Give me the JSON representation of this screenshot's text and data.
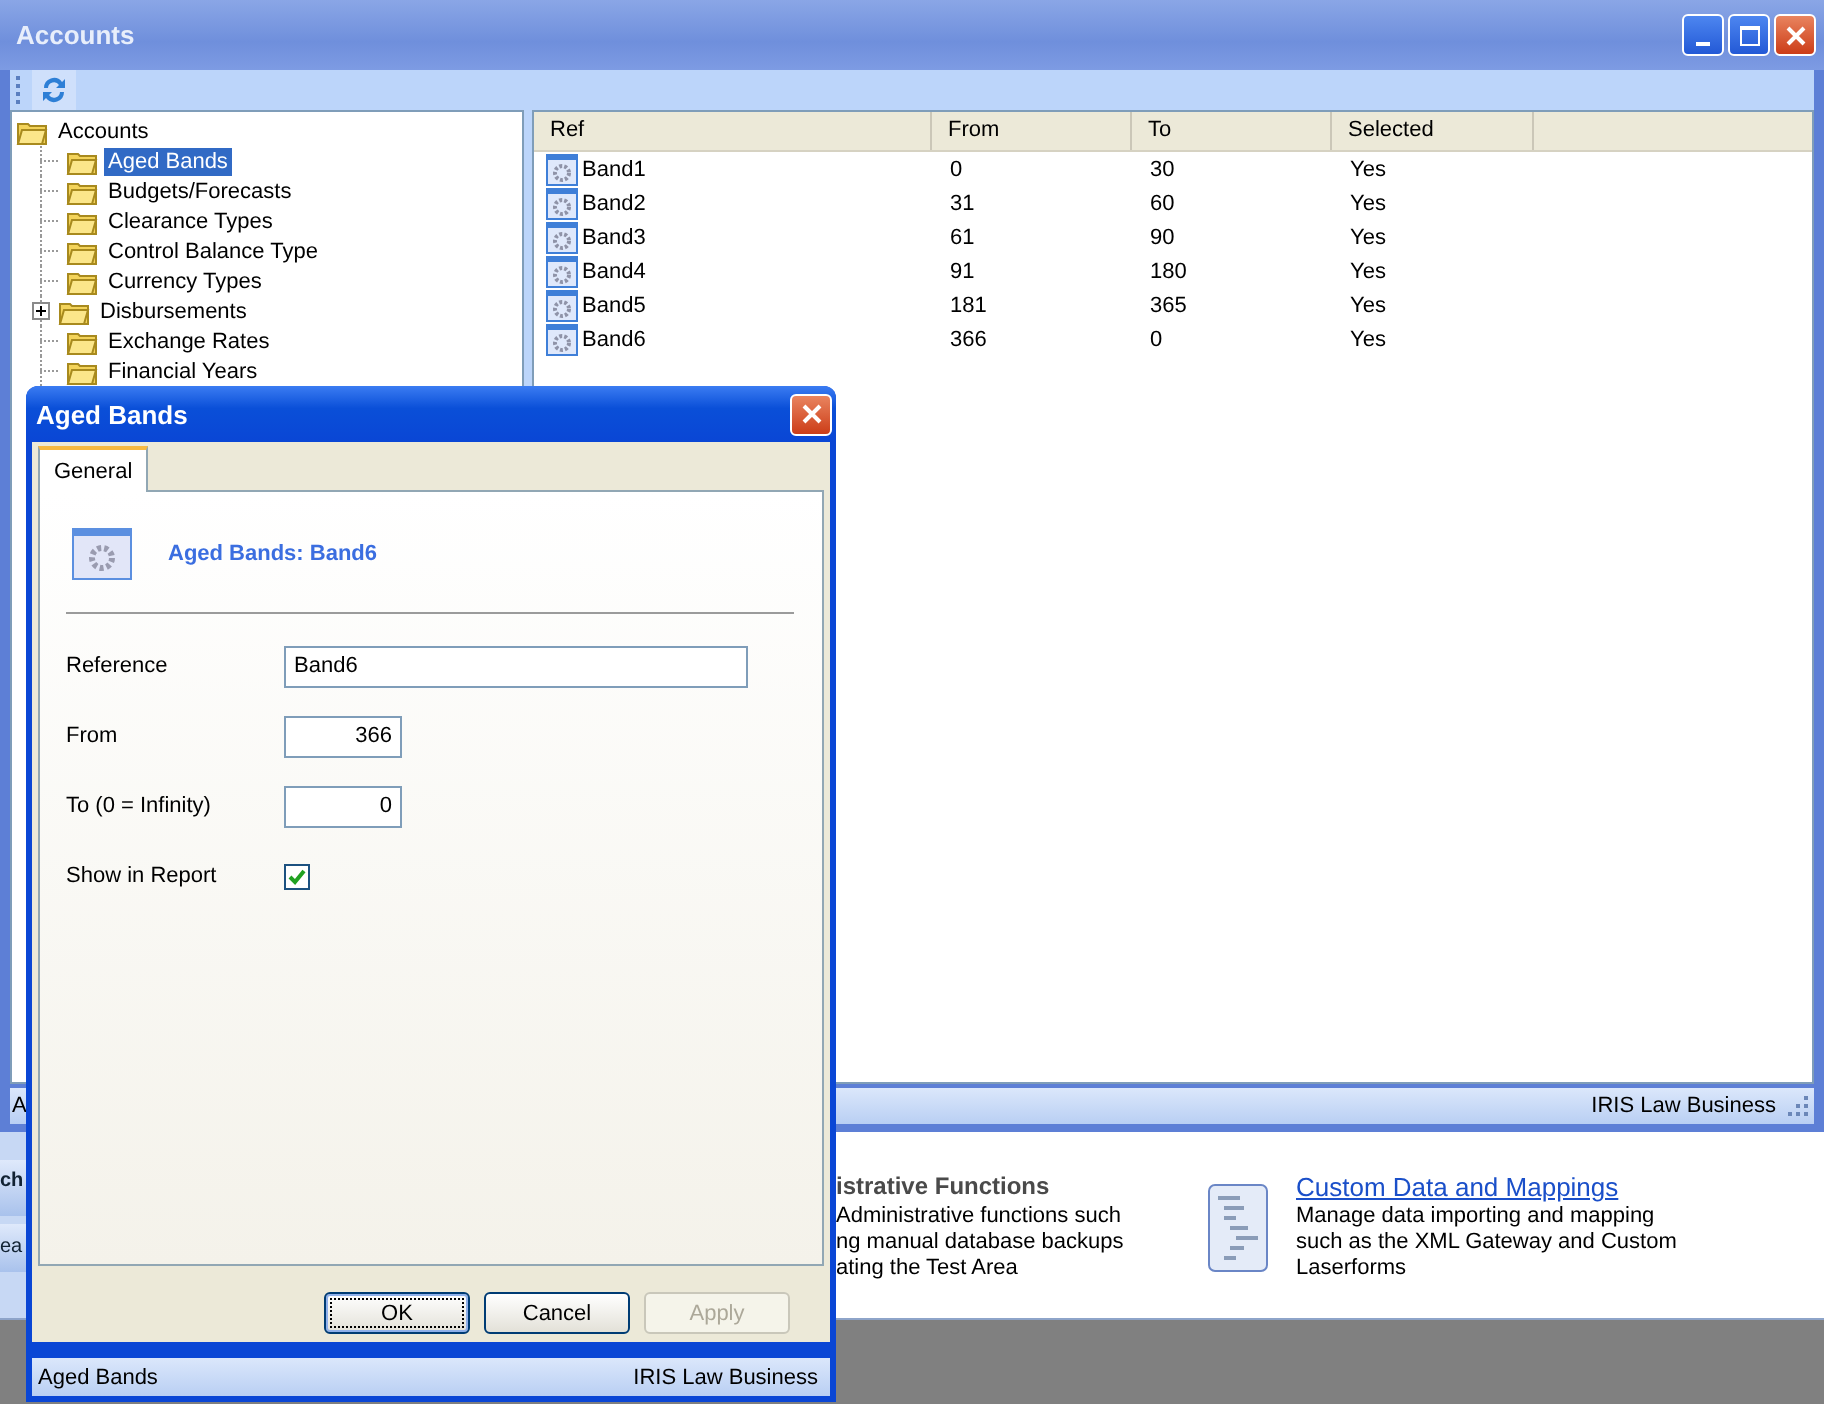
{
  "background_app": {
    "sidebar_items": [
      {
        "label": "ch",
        "kind": "bold"
      },
      {
        "label": "ea",
        "kind": "plain"
      }
    ],
    "features": [
      {
        "title": "istrative Functions",
        "kind": "heading",
        "description": [
          "Administrative functions such",
          "ng manual database backups",
          "ating the Test Area"
        ]
      },
      {
        "title": "Custom Data and Mappings",
        "kind": "link",
        "description": [
          "Manage data importing and mapping",
          "such as the XML Gateway and Custom",
          "Laserforms"
        ]
      }
    ]
  },
  "accounts_window": {
    "title": "Accounts",
    "tree": {
      "label": "Accounts",
      "children": [
        {
          "label": "Aged Bands",
          "selected": true,
          "expandable": false
        },
        {
          "label": "Budgets/Forecasts",
          "selected": false,
          "expandable": false
        },
        {
          "label": "Clearance Types",
          "selected": false,
          "expandable": false
        },
        {
          "label": "Control Balance Type",
          "selected": false,
          "expandable": false
        },
        {
          "label": "Currency Types",
          "selected": false,
          "expandable": false
        },
        {
          "label": "Disbursements",
          "selected": false,
          "expandable": true
        },
        {
          "label": "Exchange Rates",
          "selected": false,
          "expandable": false
        },
        {
          "label": "Financial Years",
          "selected": false,
          "expandable": false
        }
      ]
    },
    "table": {
      "columns": [
        "Ref",
        "From",
        "To",
        "Selected"
      ],
      "rows": [
        [
          "Band1",
          "0",
          "30",
          "Yes"
        ],
        [
          "Band2",
          "31",
          "60",
          "Yes"
        ],
        [
          "Band3",
          "61",
          "90",
          "Yes"
        ],
        [
          "Band4",
          "91",
          "180",
          "Yes"
        ],
        [
          "Band5",
          "181",
          "365",
          "Yes"
        ],
        [
          "Band6",
          "366",
          "0",
          "Yes"
        ]
      ]
    },
    "status_bar": {
      "left": "A",
      "right": "IRIS Law Business"
    }
  },
  "dialog": {
    "title": "Aged Bands",
    "tabs": [
      {
        "label": "General",
        "selected": true
      }
    ],
    "heading": "Aged Bands: Band6",
    "fields": [
      {
        "label": "Reference",
        "kind": "text",
        "value": "Band6"
      },
      {
        "label": "From",
        "kind": "number",
        "value": "366"
      },
      {
        "label": "To (0 = Infinity)",
        "kind": "number",
        "value": "0"
      },
      {
        "label": "Show in Report",
        "kind": "checkbox",
        "checked": true
      }
    ],
    "buttons": [
      {
        "label": "OK",
        "default": true,
        "disabled": false
      },
      {
        "label": "Cancel",
        "default": false,
        "disabled": false
      },
      {
        "label": "Apply",
        "default": false,
        "disabled": true
      }
    ],
    "status_bar": {
      "left": "Aged Bands",
      "right": "IRIS Law Business"
    }
  }
}
